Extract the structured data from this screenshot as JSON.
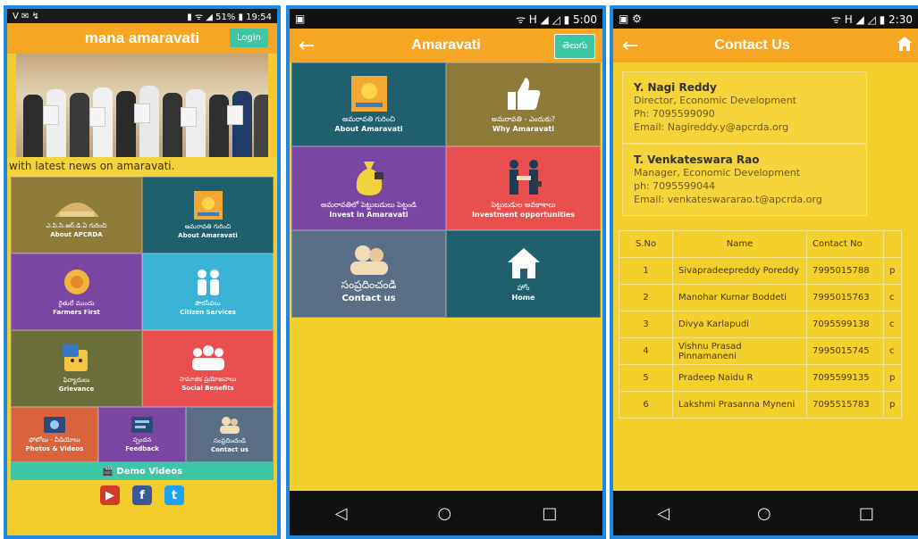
{
  "phone1": {
    "status_left": "V ✉ ↯",
    "status_right": "▮ ᯤ ◢ 51% ▮ 19:54",
    "title": "mana amaravati",
    "login_label": "Login",
    "ticker": "with latest news on amaravati.",
    "tiles": [
      {
        "te": "ఎ.పి.సి.ఆర్.డి.ఏ గురించి",
        "en": "About APCRDA",
        "color": "#8e7b3a",
        "icon": "building-icon"
      },
      {
        "te": "అమరావతి గురించి",
        "en": "About Amaravati",
        "color": "#1f5f6e",
        "icon": "sun-logo-icon"
      },
      {
        "te": "రైతులే ముందు",
        "en": "Farmers First",
        "color": "#7b45a2",
        "icon": "flower-icon"
      },
      {
        "te": "పౌరసేవలు",
        "en": "Citizen Services",
        "color": "#3ab4d6",
        "icon": "family-icon"
      },
      {
        "te": "ఫిర్యాదులు",
        "en": "Grievance",
        "color": "#6b6f3a",
        "icon": "smiley-icon"
      },
      {
        "te": "సామాజిక ప్రయోజనాలు",
        "en": "Social Benefits",
        "color": "#e94f4f",
        "icon": "people-icon"
      }
    ],
    "small_tiles": [
      {
        "te": "ఫోటోలు - వీడియోలు",
        "en": "Photos & Videos",
        "color": "#d9633d",
        "icon": "camera-icon"
      },
      {
        "te": "స్పందన",
        "en": "Feedback",
        "color": "#7b45a2",
        "icon": "feedback-icon"
      },
      {
        "te": "సంప్రదించండి",
        "en": "Contact us",
        "color": "#5a6f86",
        "icon": "contact-icon"
      }
    ],
    "demo_label": "Demo Videos"
  },
  "phone2": {
    "status_right": "ᯤ H ◢ ◿ ▮ 5:00",
    "title": "Amaravati",
    "lang_button": "తెలుగు",
    "tiles": [
      {
        "te": "అమరావతి గురించి",
        "en": "About Amaravati",
        "color": "#1f5f6e",
        "icon": "sun-logo-icon"
      },
      {
        "te": "అమరావతి - ఎందుకు?",
        "en": "Why Amaravati",
        "color": "#8e7b3a",
        "icon": "thumbs-up-icon"
      },
      {
        "te": "అమరావతిలో పెట్టుబడులు పెట్టండి",
        "en": "Invest in Amaravati",
        "color": "#7b45a2",
        "icon": "money-bag-icon"
      },
      {
        "te": "పెట్టుబడుల అవకాశాలు",
        "en": "Investment opportunities",
        "color": "#e94f4f",
        "icon": "handshake-icon"
      },
      {
        "te": "సంప్రదించండి",
        "en": "Contact us",
        "color": "#5a6f86",
        "icon": "contact-icon"
      },
      {
        "te": "హోం",
        "en": "Home",
        "color": "#1f5f6e",
        "icon": "home-icon"
      }
    ]
  },
  "phone3": {
    "status_right": "ᯤ H ◢ ◿ ▮ 2:30",
    "title": "Contact Us",
    "contacts": [
      {
        "name": "Y. Nagi Reddy",
        "role": "Director, Economic Development",
        "phone": "Ph: 7095599090",
        "email": "Email: Nagireddy.y@apcrda.org"
      },
      {
        "name": "T. Venkateswara Rao",
        "role": "Manager, Economic Development",
        "phone": "ph: 7095599044",
        "email": "Email: venkateswararao.t@apcrda.org"
      }
    ],
    "table": {
      "headers": [
        "S.No",
        "Name",
        "Contact No"
      ],
      "rows": [
        [
          "1",
          "Sivapradeepreddy Poreddy",
          "7995015788",
          "p"
        ],
        [
          "2",
          "Manohar Kumar Boddeti",
          "7995015763",
          "c"
        ],
        [
          "3",
          "Divya Karlapudi",
          "7095599138",
          "c"
        ],
        [
          "4",
          "Vishnu Prasad Pinnamaneni",
          "7995015745",
          "c"
        ],
        [
          "5",
          "Pradeep Naidu R",
          "7095599135",
          "p"
        ],
        [
          "6",
          "Lakshmi Prasanna Myneni",
          "7095515783",
          "p"
        ]
      ]
    }
  },
  "nav": {
    "back": "◁",
    "home": "○",
    "recent": "□"
  }
}
